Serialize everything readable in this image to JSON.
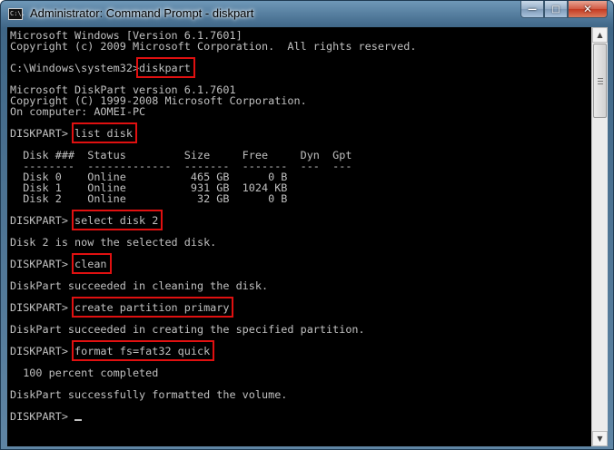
{
  "window": {
    "title": "Administrator: Command Prompt - diskpart",
    "icon_text": "C:\\.",
    "minimize_glyph": "—",
    "maximize_glyph": "□",
    "close_glyph": "✕"
  },
  "scrollbar": {
    "up_glyph": "▲",
    "down_glyph": "▼"
  },
  "console": {
    "lines": [
      "Microsoft Windows [Version 6.1.7601]",
      "Copyright (c) 2009 Microsoft Corporation.  All rights reserved.",
      "",
      "C:\\Windows\\system32>diskpart",
      "",
      "Microsoft DiskPart version 6.1.7601",
      "Copyright (C) 1999-2008 Microsoft Corporation.",
      "On computer: AOMEI-PC",
      "",
      "DISKPART> list disk",
      "",
      "  Disk ###  Status         Size     Free     Dyn  Gpt",
      "  --------  -------------  -------  -------  ---  ---",
      "  Disk 0    Online          465 GB      0 B",
      "  Disk 1    Online          931 GB  1024 KB",
      "  Disk 2    Online           32 GB      0 B",
      "",
      "DISKPART> select disk 2",
      "",
      "Disk 2 is now the selected disk.",
      "",
      "DISKPART> clean",
      "",
      "DiskPart succeeded in cleaning the disk.",
      "",
      "DISKPART> create partition primary",
      "",
      "DiskPart succeeded in creating the specified partition.",
      "",
      "DISKPART> format fs=fat32 quick",
      "",
      "  100 percent completed",
      "",
      "DiskPart successfully formatted the volume.",
      "",
      "DISKPART> "
    ],
    "highlighted_commands": [
      "diskpart",
      "list disk",
      "select disk 2",
      "clean",
      "create partition primary",
      "format fs=fat32 quick"
    ],
    "highlight_color": "#e01010",
    "text_color": "#c0c0c0",
    "background_color": "#000000"
  }
}
